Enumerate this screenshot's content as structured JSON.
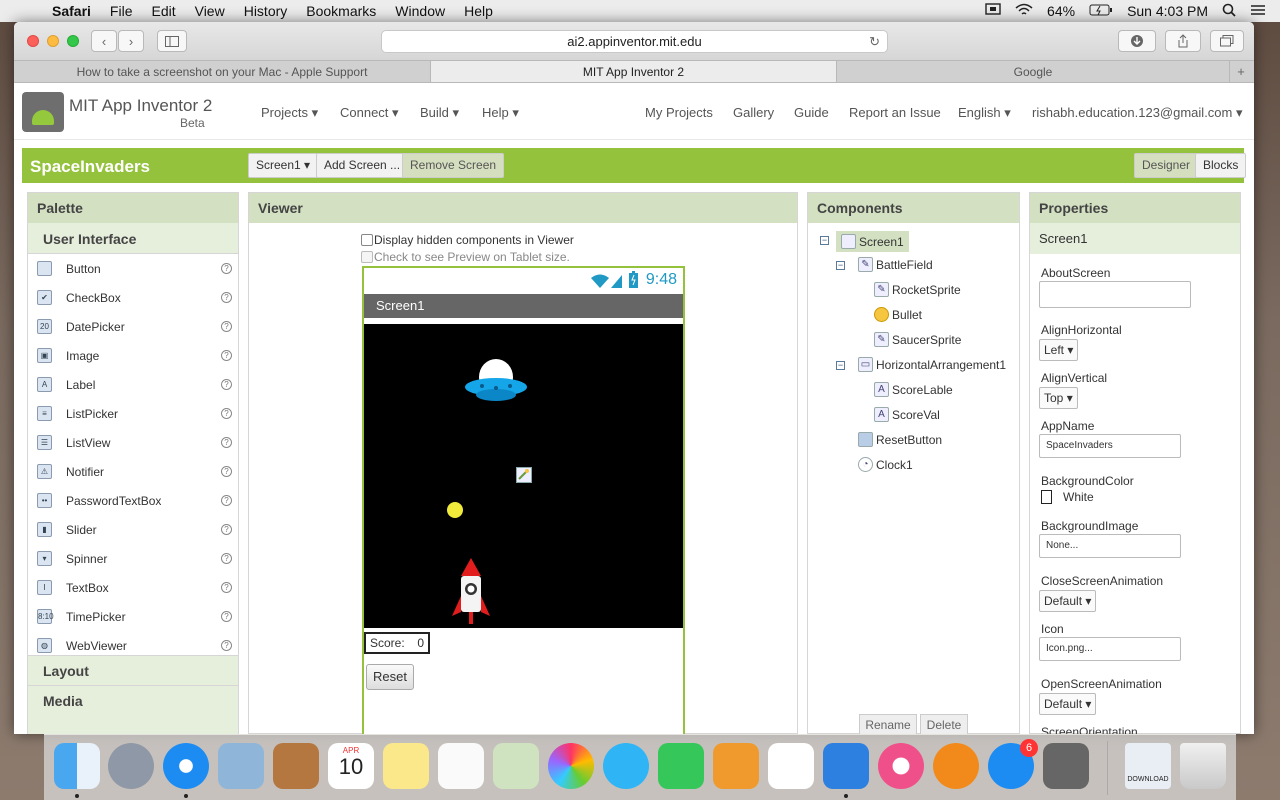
{
  "menubar": {
    "app": "Safari",
    "items": [
      "File",
      "Edit",
      "View",
      "History",
      "Bookmarks",
      "Window",
      "Help"
    ],
    "battery": "64%",
    "clock": "Sun 4:03 PM"
  },
  "browser": {
    "url": "ai2.appinventor.mit.edu",
    "tabs": [
      "How to take a screenshot on your Mac - Apple Support",
      "MIT App Inventor 2",
      "Google"
    ],
    "active_tab": 1
  },
  "header": {
    "title": "MIT App Inventor 2",
    "beta": "Beta",
    "menus": [
      "Projects",
      "Connect",
      "Build",
      "Help"
    ],
    "links": [
      "My Projects",
      "Gallery",
      "Guide",
      "Report an Issue"
    ],
    "language": "English",
    "account": "rishabh.education.123@gmail.com"
  },
  "project": {
    "name": "SpaceInvaders",
    "screen_select": "Screen1",
    "add_screen": "Add Screen ...",
    "remove_screen": "Remove Screen",
    "designer": "Designer",
    "blocks": "Blocks"
  },
  "palette": {
    "title": "Palette",
    "section": "User Interface",
    "items": [
      "Button",
      "CheckBox",
      "DatePicker",
      "Image",
      "Label",
      "ListPicker",
      "ListView",
      "Notifier",
      "PasswordTextBox",
      "Slider",
      "Spinner",
      "TextBox",
      "TimePicker",
      "WebViewer"
    ],
    "help": "?",
    "layout": "Layout",
    "media": "Media"
  },
  "viewer": {
    "title": "Viewer",
    "display_hidden": "Display hidden components in Viewer",
    "tablet_preview": "Check to see Preview on Tablet size.",
    "phone_time": "9:48",
    "screen_title": "Screen1",
    "score_label": "Score:",
    "score_value": "0",
    "reset_label": "Reset"
  },
  "components": {
    "title": "Components",
    "tree": [
      "Screen1",
      "BattleField",
      "RocketSprite",
      "Bullet",
      "SaucerSprite",
      "HorizontalArrangement1",
      "ScoreLable",
      "ScoreVal",
      "ResetButton",
      "Clock1"
    ],
    "rename": "Rename",
    "delete": "Delete"
  },
  "properties": {
    "title": "Properties",
    "component": "Screen1",
    "about_screen": "AboutScreen",
    "align_horizontal": "AlignHorizontal",
    "align_horizontal_value": "Left",
    "align_vertical": "AlignVertical",
    "align_vertical_value": "Top",
    "app_name": "AppName",
    "app_name_value": "SpaceInvaders",
    "background_color": "BackgroundColor",
    "background_color_value": "White",
    "background_image": "BackgroundImage",
    "background_image_value": "None...",
    "close_screen_animation": "CloseScreenAnimation",
    "close_screen_animation_value": "Default",
    "icon": "Icon",
    "icon_value": "Icon.png...",
    "open_screen_animation": "OpenScreenAnimation",
    "open_screen_animation_value": "Default",
    "screen_orientation": "ScreenOrientation"
  },
  "dock": {
    "calendar_month": "APR",
    "calendar_day": "10",
    "appstore_badge": "6",
    "download_label": "DOWNLOAD"
  },
  "colors": {
    "green_bar": "#95c23d",
    "panel_header": "#d3e1c2",
    "phone_time": "#2199c5"
  }
}
